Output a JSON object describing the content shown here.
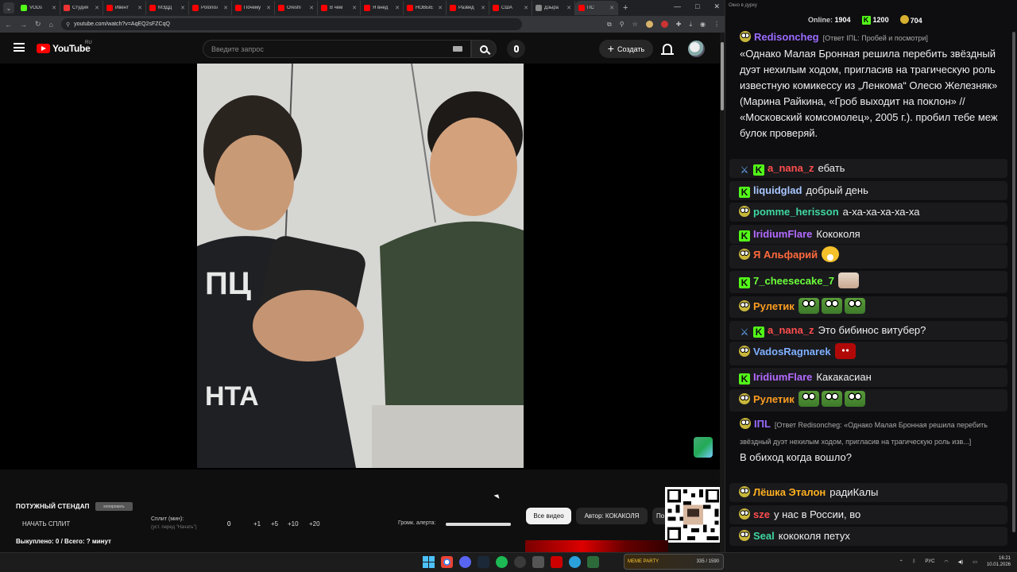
{
  "browser": {
    "tabs": [
      {
        "label": "VODs",
        "color": "#53fc18"
      },
      {
        "label": "Студия",
        "color": "#e33"
      },
      {
        "label": "Ивент",
        "color": "#f00"
      },
      {
        "label": "МЭДД",
        "color": "#f00"
      },
      {
        "label": "Polonisi",
        "color": "#f00"
      },
      {
        "label": "Почему",
        "color": "#f00"
      },
      {
        "label": "Oreshi",
        "color": "#f00"
      },
      {
        "label": "В чем",
        "color": "#f00"
      },
      {
        "label": "Я внед",
        "color": "#f00"
      },
      {
        "label": "НОВЫЕ",
        "color": "#f00"
      },
      {
        "label": "Развед",
        "color": "#f00"
      },
      {
        "label": "США",
        "color": "#f00"
      },
      {
        "label": "Дзыра",
        "color": "#888"
      },
      {
        "label": "ПС",
        "color": "#f00"
      }
    ],
    "url": "youtube.com/watch?v=AqEQ2sFZCqQ"
  },
  "youtube": {
    "logo_text": "YouTube",
    "region": "RU",
    "search_placeholder": "Введите запрос",
    "create_label": "Создать"
  },
  "panel": {
    "title": "ПОТУЖНЫЙ СТЕНДАП",
    "copy_label": "копировать",
    "start_split": "НАЧАТЬ СПЛИТ",
    "split_label": "Сплит (мин):",
    "split_hint": "(уст. перед \"Начать\")",
    "split_value": "0",
    "split_buttons": [
      "+1",
      "+5",
      "+10",
      "+20"
    ],
    "alert_label": "Громк. алерта:",
    "alert_volume": 1.0,
    "bought": "Выкуплено: 0 / Всего: ? минут",
    "chips": {
      "all": "Все видео",
      "author": "Автор: КОКАКОЛЯ",
      "more": "По"
    }
  },
  "chat": {
    "window_title": "Окно в дурку",
    "online_label": "Online:",
    "online_value": "1904",
    "kick_count": "1200",
    "coin_count": "704",
    "messages": [
      {
        "badges": [
          "pepe"
        ],
        "user": "Redisoncheg",
        "color": "#9b6bff",
        "reply": "[Ответ IПL: Пробей и посмотри]",
        "text": "«Однако Малая Бронная решила перебить звёздный дуэт нехилым ходом, пригласив на трагическую роль известную комикессу из „Ленкома“ Олесю Железняк» (Марина Райкина, «Гроб выходит на поклон» // «Московский комсомолец», 2005 г.). пробил тебе меж булок проверяй."
      },
      {
        "badges": [
          "sword",
          "kick"
        ],
        "user": "a_nana_z",
        "color": "#ff4d4d",
        "text": "ебать"
      },
      {
        "badges": [
          "kick"
        ],
        "user": "liquidglad",
        "color": "#a9c7ff",
        "text": "добрый день"
      },
      {
        "badges": [
          "pepe"
        ],
        "user": "pomme_herisson",
        "color": "#3fd7a0",
        "text": "а-ха-ха-ха-ха-ха"
      },
      {
        "badges": [
          "kick"
        ],
        "user": "IridiumFlare",
        "color": "#b36bff",
        "text": "Кококоля"
      },
      {
        "badges": [
          "pepe"
        ],
        "user": "Я Альфарий",
        "color": "#ff6a3d",
        "text": "",
        "emotes": [
          "laugh"
        ]
      },
      {
        "badges": [
          "kick"
        ],
        "user": "7_cheesecake_7",
        "color": "#6cff3a",
        "text": "",
        "emotes": [
          "cat"
        ]
      },
      {
        "badges": [
          "pepe"
        ],
        "user": "Рулетик",
        "color": "#ff9e1f",
        "text": "",
        "emotes": [
          "pepe",
          "pepe",
          "pepe"
        ]
      },
      {
        "badges": [
          "sword",
          "kick"
        ],
        "user": "a_nana_z",
        "color": "#ff4d4d",
        "text": "Это бибинос витубер?"
      },
      {
        "badges": [
          "pepe"
        ],
        "user": "VadosRagnarek",
        "color": "#7fb0ff",
        "text": "",
        "emotes": [
          "red"
        ]
      },
      {
        "badges": [
          "kick"
        ],
        "user": "IridiumFlare",
        "color": "#b36bff",
        "text": "Какакасиан"
      },
      {
        "badges": [
          "pepe"
        ],
        "user": "Рулетик",
        "color": "#ff9e1f",
        "text": "",
        "emotes": [
          "pepe",
          "pepe",
          "pepe"
        ]
      },
      {
        "badges": [
          "pepe"
        ],
        "user": "IПL",
        "color": "#9b6bff",
        "reply": "[Ответ Redisoncheg: «Однако Малая Бронная решила перебить звёздный дуэт нехилым ходом, пригласив на трагическую роль изв...]",
        "text": "В обиход когда вошло?"
      },
      {
        "badges": [
          "pepe"
        ],
        "user": "Лёшка Эталон",
        "color": "#ffb020",
        "text": "радиКалы"
      },
      {
        "badges": [
          "pepe"
        ],
        "user": "sze",
        "color": "#ff4d4d",
        "text": "у нас в России, во"
      },
      {
        "badges": [
          "pepe"
        ],
        "user": "Seal",
        "color": "#3fd7a0",
        "text": "кококоля петух"
      }
    ]
  },
  "taskbar": {
    "promo_label": "MEME PARTY",
    "promo_progress": "335 / 1590",
    "lang": "РУС",
    "time": "16:21",
    "date": "10.01.2026"
  }
}
